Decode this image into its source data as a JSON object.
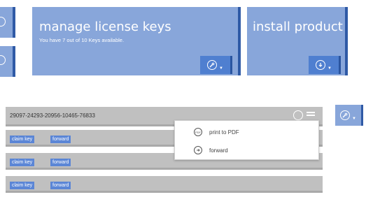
{
  "tiles": {
    "license": {
      "title": "manage license keys",
      "subtitle": "You have 7 out of 10 Keys available.",
      "button_icon": "wrench-icon"
    },
    "install": {
      "title": "install product",
      "button_icon": "download-icon"
    }
  },
  "license_panel": {
    "key_value": "29097-24293-20956-10465-76833",
    "rows": [
      {
        "claim_label": "claim key",
        "forward_label": "forward"
      },
      {
        "claim_label": "claim key",
        "forward_label": "forward"
      },
      {
        "claim_label": "claim key",
        "forward_label": "forward"
      }
    ],
    "context_menu": {
      "items": [
        {
          "label": "print to PDF",
          "icon": "pdf-icon"
        },
        {
          "label": "forward",
          "icon": "forward-icon"
        }
      ]
    }
  },
  "colors": {
    "tile_bg": "#88a6da",
    "tile_accent": "#2f5aa6",
    "row_bg": "#c0c0c0",
    "chip_bg": "#5b86d6"
  }
}
